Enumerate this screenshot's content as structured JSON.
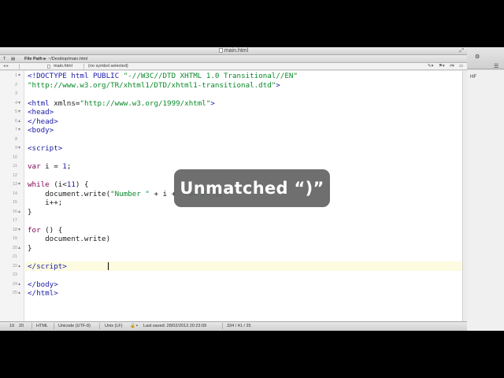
{
  "window": {
    "title": "main.html",
    "filepath_label": "File Path ▸",
    "filepath": ": ~/Desktop/main.html"
  },
  "nav": {
    "file_tab": "main.html",
    "symbol": "(no symbol selected)",
    "arrows": "◂ ▸"
  },
  "code_lines": [
    {
      "n": "1",
      "html": "<span class=\"tag\">&lt;!DOCTYPE html PUBLIC</span> <span class=\"str\">\"-//W3C//DTD XHTML 1.0 Transitional//EN\"</span>"
    },
    {
      "n": "2",
      "html": "<span class=\"str\">\"http://www.w3.org/TR/xhtml1/DTD/xhtml1-transitional.dtd\"</span><span class=\"tag\">&gt;</span>"
    },
    {
      "n": "3",
      "html": ""
    },
    {
      "n": "4",
      "html": "<span class=\"tag\">&lt;html</span> xmlns=<span class=\"str\">\"http://www.w3.org/1999/xhtml\"</span><span class=\"tag\">&gt;</span>"
    },
    {
      "n": "5",
      "html": "<span class=\"tag\">&lt;head&gt;</span>"
    },
    {
      "n": "6",
      "html": "<span class=\"tag\">&lt;/head&gt;</span>"
    },
    {
      "n": "7",
      "html": "<span class=\"tag\">&lt;body&gt;</span>"
    },
    {
      "n": "8",
      "html": ""
    },
    {
      "n": "9",
      "html": "<span class=\"tag\">&lt;script&gt;</span>"
    },
    {
      "n": "10",
      "html": ""
    },
    {
      "n": "11",
      "html": "<span class=\"kw\">var</span> i = <span class=\"num\">1</span>;"
    },
    {
      "n": "12",
      "html": ""
    },
    {
      "n": "13",
      "html": "<span class=\"kw\">while</span> (i&lt;<span class=\"num\">11</span>) {"
    },
    {
      "n": "14",
      "html": "    document.write(<span class=\"str\">\"Number \"</span> + i + <span class=\"str\">\"&lt;br /&gt;\"</span>);"
    },
    {
      "n": "15",
      "html": "    i++;"
    },
    {
      "n": "16",
      "html": "}"
    },
    {
      "n": "17",
      "html": ""
    },
    {
      "n": "18",
      "html": "<span class=\"kw\">for</span> () {"
    },
    {
      "n": "19",
      "html": "    document.write)"
    },
    {
      "n": "20",
      "html": "}"
    },
    {
      "n": "21",
      "html": ""
    },
    {
      "n": "22",
      "html": "<span class=\"tag\">&lt;/script&gt;</span>"
    },
    {
      "n": "23",
      "html": ""
    },
    {
      "n": "24",
      "html": "<span class=\"tag\">&lt;/body&gt;</span>"
    },
    {
      "n": "25",
      "html": "<span class=\"tag\">&lt;/html&gt;</span>"
    }
  ],
  "fold_markers": {
    "1": "▾",
    "4": "▾",
    "5": "▾",
    "6": "▴",
    "7": "▾",
    "9": "▾",
    "13": "▾",
    "16": "▴",
    "18": "▾",
    "20": "▴",
    "22": "▴",
    "24": "▴",
    "25": "▴"
  },
  "status": {
    "line": "19",
    "col": "20",
    "syntax": "HTML",
    "encoding": "Unicode (UTF-8)",
    "line_endings": "Unix (LF)",
    "last_saved": "Last saved: 28/02/2013 20:23:09",
    "stats": "334 / 41 / 25"
  },
  "side": {
    "label": "HF",
    "menu_icon": "☰",
    "settings_icon": "⚙"
  },
  "overlay": {
    "message": "Unmatched “)”"
  }
}
